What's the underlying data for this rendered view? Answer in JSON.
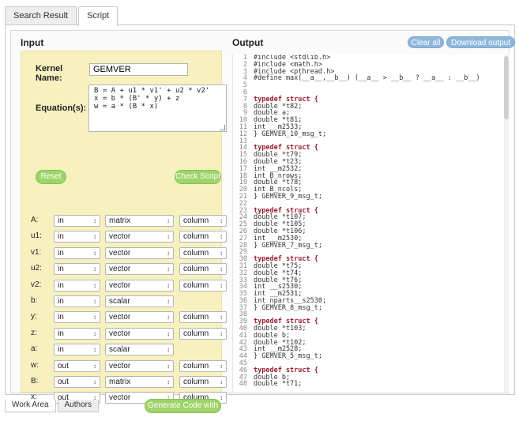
{
  "tabs": [
    {
      "label": "Search Result"
    },
    {
      "label": "Script"
    }
  ],
  "input": {
    "title": "Input",
    "kernel_label": "Kernel Name:",
    "kernel_value": "GEMVER",
    "equation_label": "Equation(s):",
    "equations": "B = A + u1 * v1' + u2 * v2'\nx = b * (B' * y) + z\nw = a * (B * x)",
    "reset_label": "Reset",
    "check_label": "Check Script",
    "generate_label": "Generate Code with BTO",
    "rows": [
      {
        "name": "A:",
        "io": "in",
        "type": "matrix",
        "layout": "column"
      },
      {
        "name": "u1:",
        "io": "in",
        "type": "vector",
        "layout": "column"
      },
      {
        "name": "v1:",
        "io": "in",
        "type": "vector",
        "layout": "column"
      },
      {
        "name": "u2:",
        "io": "in",
        "type": "vector",
        "layout": "column"
      },
      {
        "name": "v2:",
        "io": "in",
        "type": "vector",
        "layout": "column"
      },
      {
        "name": "b:",
        "io": "in",
        "type": "scalar",
        "layout": ""
      },
      {
        "name": "y:",
        "io": "in",
        "type": "vector",
        "layout": "column"
      },
      {
        "name": "z:",
        "io": "in",
        "type": "vector",
        "layout": "column"
      },
      {
        "name": "a:",
        "io": "in",
        "type": "scalar",
        "layout": ""
      },
      {
        "name": "w:",
        "io": "out",
        "type": "vector",
        "layout": "column"
      },
      {
        "name": "B:",
        "io": "out",
        "type": "matrix",
        "layout": "column"
      },
      {
        "name": "x:",
        "io": "out",
        "type": "vector",
        "layout": "column"
      }
    ]
  },
  "output": {
    "title": "Output",
    "clear_label": "Clear all",
    "download_label": "Download output file",
    "code_lines": [
      {
        "n": "1",
        "t": "#include <stdlib.h>"
      },
      {
        "n": "2",
        "t": "#include <math.h>"
      },
      {
        "n": "3",
        "t": "#include <pthread.h>"
      },
      {
        "n": "4",
        "t": "#define max(__a__,__b__) (__a__ > __b__ ? __a__ : __b__)"
      },
      {
        "n": "5",
        "t": ""
      },
      {
        "n": "6",
        "t": ""
      },
      {
        "n": "7",
        "t": "typedef struct {",
        "kw": true
      },
      {
        "n": "8",
        "t": "double *t82;"
      },
      {
        "n": "9",
        "t": "double a;"
      },
      {
        "n": "10",
        "t": "double *t81;"
      },
      {
        "n": "11",
        "t": "int __m2533;"
      },
      {
        "n": "12",
        "t": "} GEMVER_10_msg_t;"
      },
      {
        "n": "13",
        "t": ""
      },
      {
        "n": "14",
        "t": "typedef struct {",
        "kw": true
      },
      {
        "n": "15",
        "t": "double *t79;"
      },
      {
        "n": "16",
        "t": "double *t23;"
      },
      {
        "n": "17",
        "t": "int __m2532;"
      },
      {
        "n": "18",
        "t": "int B_nrows;"
      },
      {
        "n": "19",
        "t": "double *t78;"
      },
      {
        "n": "20",
        "t": "int B_ncols;"
      },
      {
        "n": "21",
        "t": "} GEMVER_9_msg_t;"
      },
      {
        "n": "22",
        "t": ""
      },
      {
        "n": "23",
        "t": "typedef struct {",
        "kw": true
      },
      {
        "n": "24",
        "t": "double *t107;"
      },
      {
        "n": "25",
        "t": "double *t105;"
      },
      {
        "n": "26",
        "t": "double *t106;"
      },
      {
        "n": "27",
        "t": "int __m2530;"
      },
      {
        "n": "28",
        "t": "} GEMVER_7_msg_t;"
      },
      {
        "n": "29",
        "t": ""
      },
      {
        "n": "30",
        "t": "typedef struct {",
        "kw": true
      },
      {
        "n": "31",
        "t": "double *t75;"
      },
      {
        "n": "32",
        "t": "double *t74;"
      },
      {
        "n": "33",
        "t": "double *t76;"
      },
      {
        "n": "34",
        "t": "int __s2530;"
      },
      {
        "n": "35",
        "t": "int __m2531;"
      },
      {
        "n": "36",
        "t": "int nparts__s2530;"
      },
      {
        "n": "37",
        "t": "} GEMVER_8_msg_t;"
      },
      {
        "n": "38",
        "t": ""
      },
      {
        "n": "39",
        "t": "typedef struct {",
        "kw": true
      },
      {
        "n": "40",
        "t": "double *t103;"
      },
      {
        "n": "41",
        "t": "double b;"
      },
      {
        "n": "42",
        "t": "double *t102;"
      },
      {
        "n": "43",
        "t": "int __m2528;"
      },
      {
        "n": "44",
        "t": "} GEMVER_5_msg_t;"
      },
      {
        "n": "45",
        "t": ""
      },
      {
        "n": "46",
        "t": "typedef struct {",
        "kw": true
      },
      {
        "n": "47",
        "t": "double b;"
      },
      {
        "n": "48",
        "t": "double *t71;"
      }
    ]
  },
  "bottom_tabs": [
    {
      "label": "Work Area"
    },
    {
      "label": "Authors"
    }
  ]
}
